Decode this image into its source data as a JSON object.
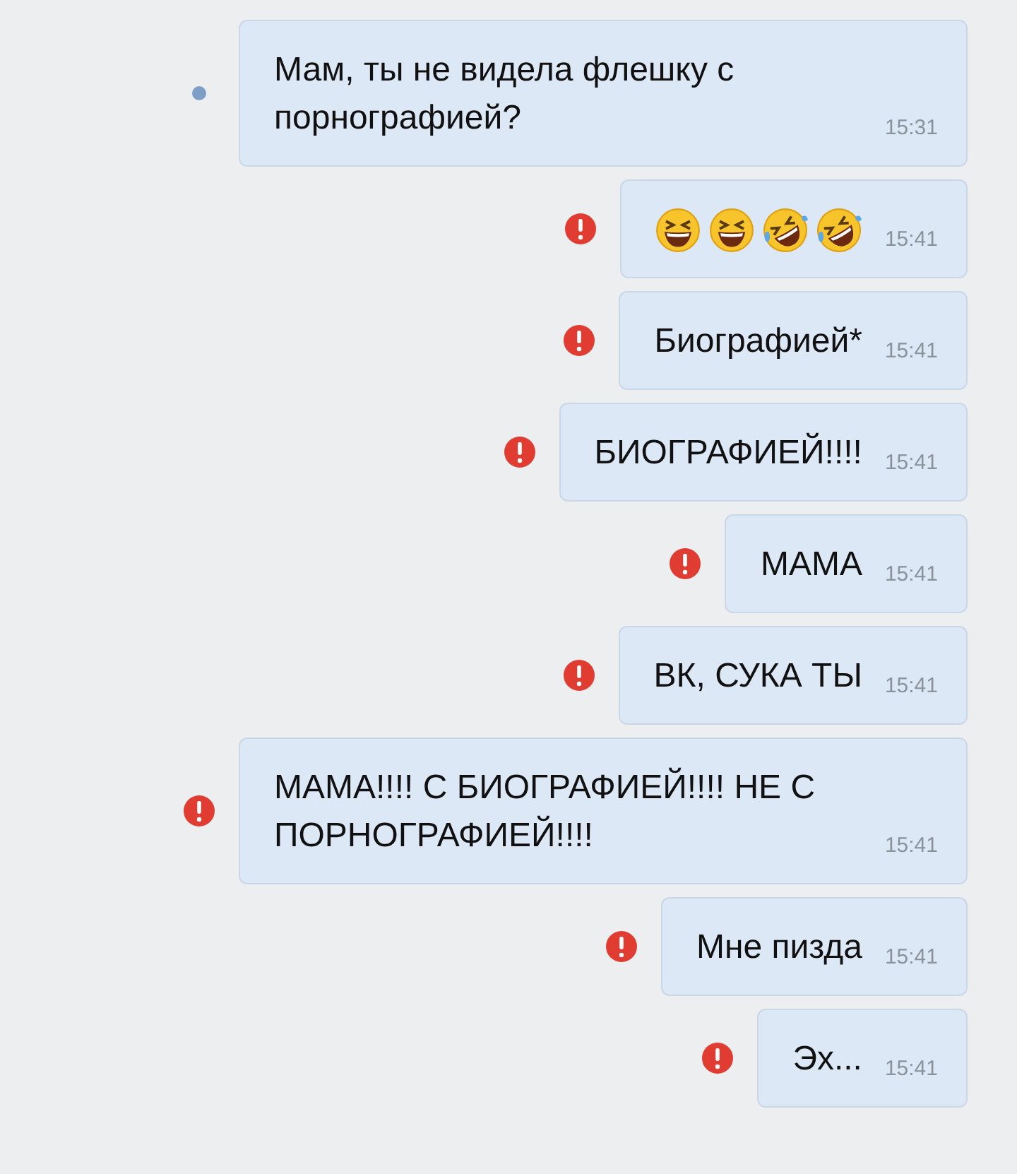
{
  "messages": [
    {
      "kind": "text",
      "unread": true,
      "failed": false,
      "text": "Мам, ты не видела флешку с порнографией?",
      "time": "15:31"
    },
    {
      "kind": "emoji",
      "unread": false,
      "failed": true,
      "emojis": [
        {
          "kind": "squint"
        },
        {
          "kind": "squint"
        },
        {
          "kind": "rofl"
        },
        {
          "kind": "rofl"
        }
      ],
      "time": "15:41"
    },
    {
      "kind": "text",
      "unread": false,
      "failed": true,
      "text": "Биографией*",
      "time": "15:41"
    },
    {
      "kind": "text",
      "unread": false,
      "failed": true,
      "text": "БИОГРАФИЕЙ!!!!",
      "time": "15:41"
    },
    {
      "kind": "text",
      "unread": false,
      "failed": true,
      "text": "МАМА",
      "time": "15:41"
    },
    {
      "kind": "text",
      "unread": false,
      "failed": true,
      "text": "ВК, СУКА ТЫ",
      "time": "15:41"
    },
    {
      "kind": "text",
      "unread": false,
      "failed": true,
      "text": "МАМА!!!! С БИОГРАФИЕЙ!!!! НЕ С ПОРНОГРАФИЕЙ!!!!",
      "time": "15:41"
    },
    {
      "kind": "text",
      "unread": false,
      "failed": true,
      "text": "Мне пизда",
      "time": "15:41"
    },
    {
      "kind": "text",
      "unread": false,
      "failed": true,
      "text": "Эх...",
      "time": "15:41"
    }
  ]
}
